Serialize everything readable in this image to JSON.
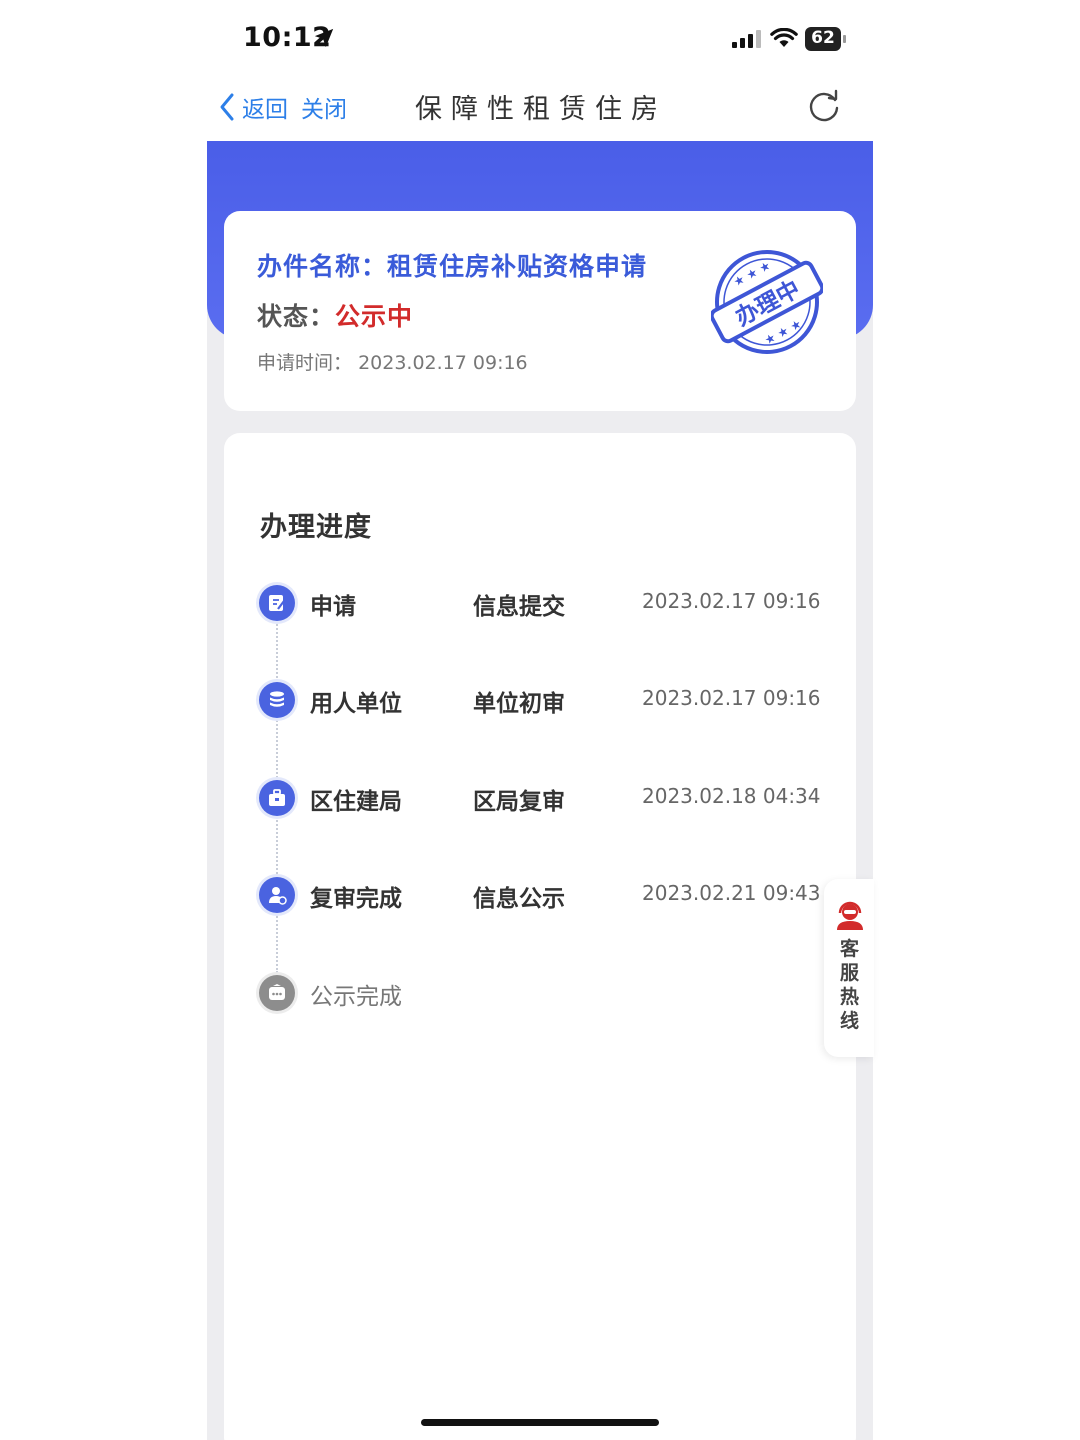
{
  "status_bar": {
    "time": "10:12",
    "battery": "62"
  },
  "nav": {
    "back_label": "返回",
    "close_label": "关闭",
    "title": "保障性租赁住房"
  },
  "case": {
    "name_label": "办件名称：",
    "name_value": "租赁住房补贴资格申请",
    "status_label": "状态：",
    "status_value": "公示中",
    "time_label": "申请时间：",
    "time_value": "2023.02.17 09:16",
    "stamp_text": "办理中"
  },
  "progress": {
    "title": "办理进度",
    "steps": [
      {
        "name": "申请",
        "action": "信息提交",
        "time": "2023.02.17 09:16",
        "icon": "edit-icon",
        "done": true
      },
      {
        "name": "用人单位",
        "action": "单位初审",
        "time": "2023.02.17 09:16",
        "icon": "database-icon",
        "done": true
      },
      {
        "name": "区住建局",
        "action": "区局复审",
        "time": "2023.02.18 04:34",
        "icon": "briefcase-icon",
        "done": true
      },
      {
        "name": "复审完成",
        "action": "信息公示",
        "time": "2023.02.21 09:43",
        "icon": "user-check-icon",
        "done": true
      },
      {
        "name": "公示完成",
        "action": "",
        "time": "",
        "icon": "message-icon",
        "done": false
      }
    ]
  },
  "hotline": {
    "label": "客服热线"
  },
  "colors": {
    "primary": "#4a5ee8",
    "link": "#2d7fe8",
    "status_red": "#d22b2b",
    "pending_gray": "#8d8d8d"
  }
}
